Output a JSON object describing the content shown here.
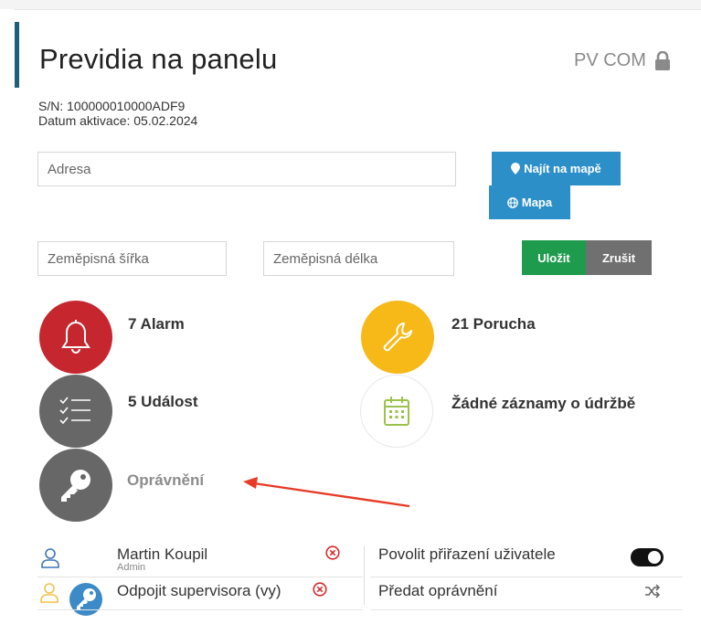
{
  "header": {
    "title": "Previdia na panelu",
    "device_label": "PV COM"
  },
  "meta": {
    "serial": "S/N: 100000010000ADF9",
    "activation": "Datum aktivace: 05.02.2024"
  },
  "location": {
    "address_placeholder": "Adresa",
    "lat_placeholder": "Zeměpisná šířka",
    "lon_placeholder": "Zeměpisná délka",
    "find_on_map_label": "Najít na mapě",
    "map_label": "Mapa",
    "save_label": "Uložit",
    "cancel_label": "Zrušit"
  },
  "stats": {
    "alarm": "7 Alarm",
    "fault": "21 Porucha",
    "event": "5 Událost",
    "maintenance": "Žádné záznamy o údržbě",
    "permissions": "Oprávnění"
  },
  "users": {
    "user_name": "Martin Koupil",
    "user_role": "Admin",
    "disconnect_label": "Odpojit supervisora (vy)",
    "allow_assign_label": "Povolit přiřazení uživatele",
    "transfer_label": "Předat oprávnění",
    "allow_assign_enabled": true
  },
  "colors": {
    "alarm": "#c6262e",
    "fault": "#f7b918",
    "event": "#676767",
    "accent": "#1f5f7a",
    "annotation_arrow": "#e83a26"
  }
}
